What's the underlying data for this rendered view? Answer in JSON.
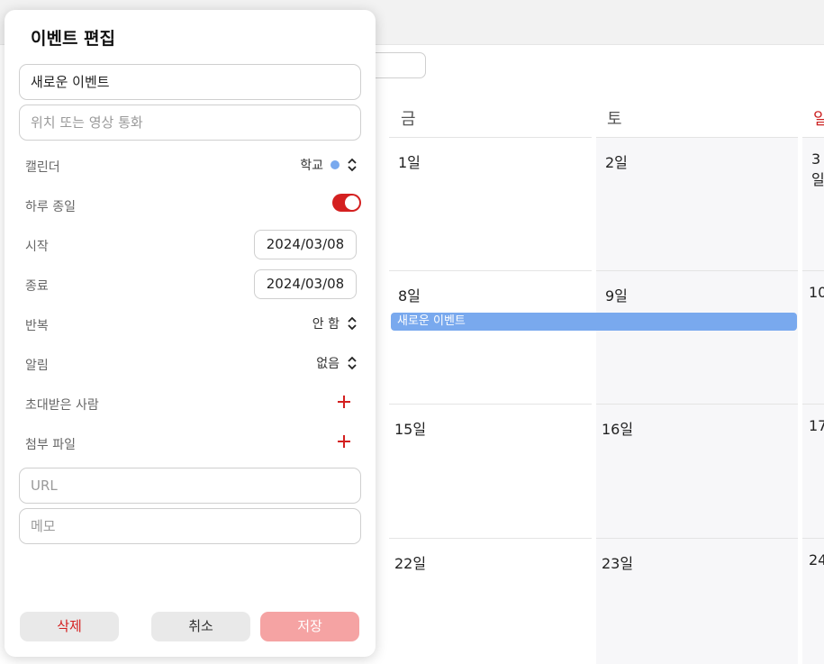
{
  "popover": {
    "title": "이벤트 편집",
    "event_title_value": "새로운 이벤트",
    "location_placeholder": "위치 또는 영상 통화",
    "calendar_label": "캘린더",
    "calendar_value": "학교",
    "calendar_color": "#79a9ee",
    "all_day_label": "하루 종일",
    "all_day_on": true,
    "start_label": "시작",
    "start_value": "2024/03/08",
    "end_label": "종료",
    "end_value": "2024/03/08",
    "repeat_label": "반복",
    "repeat_value": "안 함",
    "alert_label": "알림",
    "alert_value": "없음",
    "invitees_label": "초대받은 사람",
    "attachments_label": "첨부 파일",
    "url_placeholder": "URL",
    "memo_placeholder": "메모",
    "delete_label": "삭제",
    "cancel_label": "취소",
    "save_label": "저장",
    "accent_color": "#d42020"
  },
  "calendar": {
    "weekday_fri": "금",
    "weekday_sat": "토",
    "weekday_sun": "일",
    "days": {
      "d1": "1일",
      "d2": "2일",
      "d3": "3일",
      "d8": "8일",
      "d9": "9일",
      "d10": "10",
      "d15": "15일",
      "d16": "16일",
      "d17": "17",
      "d22": "22일",
      "d23": "23일",
      "d24": "24"
    },
    "event_title": "새로운 이벤트",
    "event_color": "#79a9ee"
  }
}
